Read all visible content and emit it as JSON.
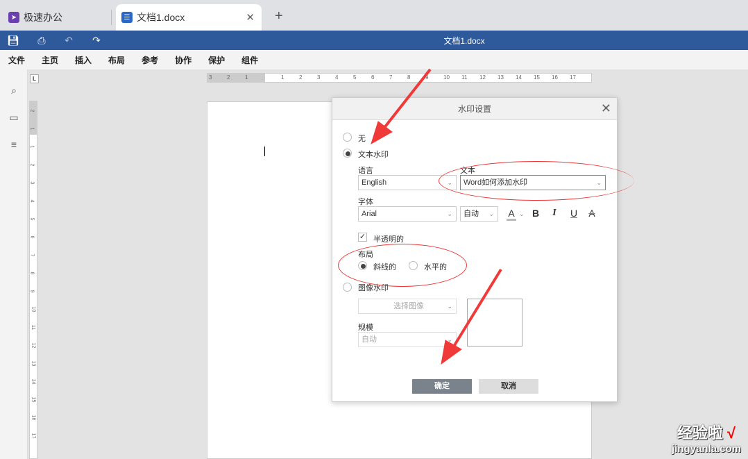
{
  "tabs": [
    {
      "label": "极速办公",
      "icon": "rocket-icon",
      "color": "#6b3fb0"
    },
    {
      "label": "文档1.docx",
      "icon": "document-icon",
      "color": "#2b67c6"
    }
  ],
  "toolbar": {
    "title": "文档1.docx",
    "bg": "#2e5a9c"
  },
  "menu": [
    "文件",
    "主页",
    "插入",
    "布局",
    "参考",
    "协作",
    "保护",
    "组件"
  ],
  "ruler": {
    "left": [
      "3",
      "2",
      "1"
    ],
    "right": [
      "1",
      "2",
      "3",
      "4",
      "5",
      "6",
      "7",
      "8",
      "9",
      "10",
      "11",
      "12",
      "13",
      "14",
      "15",
      "16",
      "17"
    ],
    "vertical": [
      "2",
      "1",
      "1",
      "2",
      "3",
      "4",
      "5",
      "6",
      "7",
      "8",
      "9",
      "10",
      "11",
      "12",
      "13",
      "14",
      "15",
      "16",
      "17"
    ]
  },
  "dialog": {
    "title": "水印设置",
    "none_label": "无",
    "text_watermark_label": "文本水印",
    "language_label": "语言",
    "language_value": "English",
    "text_label": "文本",
    "text_value": "Word如何添加水印",
    "font_label": "字体",
    "font_value": "Arial",
    "size_value": "自动",
    "format": {
      "color": "A",
      "bold": "B",
      "italic": "I",
      "underline": "U",
      "strike": "A"
    },
    "semi_transparent_label": "半透明的",
    "semi_transparent_checked": true,
    "layout_label": "布局",
    "diagonal_label": "斜线的",
    "horizontal_label": "水平的",
    "layout_selected": "斜线的",
    "image_watermark_label": "图像水印",
    "select_image_label": "选择图像",
    "scale_label": "规模",
    "scale_value": "自动",
    "ok_label": "确定",
    "cancel_label": "取消",
    "selected": "文本水印"
  },
  "watermark": {
    "line1": "经验啦",
    "line2": "jingyanla.com",
    "check": "√"
  }
}
